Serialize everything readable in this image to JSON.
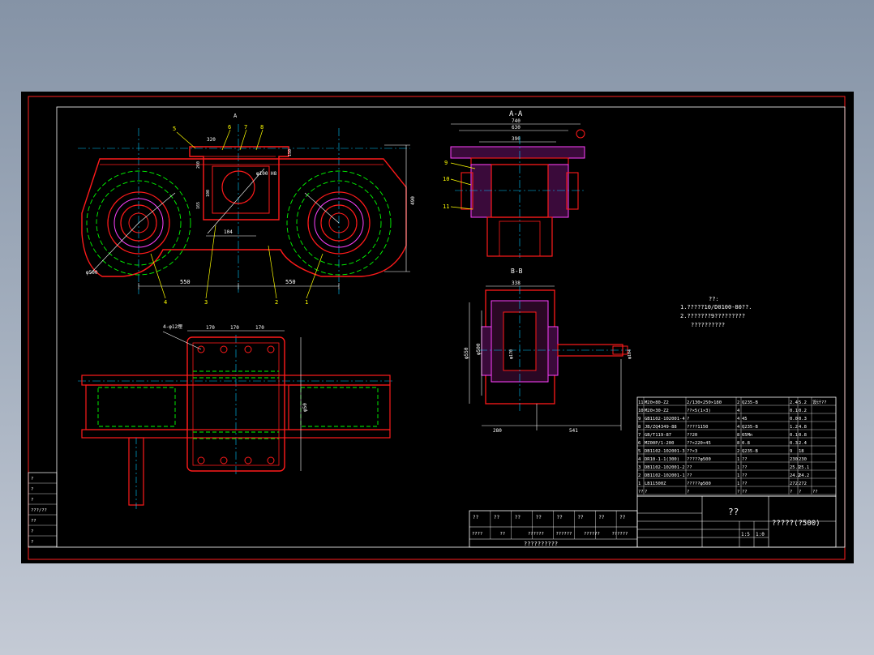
{
  "colors": {
    "frame": "#ff2020",
    "outline": "#ff1a1a",
    "centerline": "#00c8ff",
    "hidden": "#00ff00",
    "dimension": "#ffffff",
    "leader": "#ffff00",
    "hatch": "#ff40ff",
    "text": "#ffffff",
    "background": "#000000"
  },
  "views": {
    "section_aa_title": "A-A",
    "section_bb_title": "B-B"
  },
  "front_view": {
    "dims": [
      "550",
      "550",
      "320",
      "104",
      "φ100 H8",
      "φ500",
      "490",
      "150",
      "165",
      "260",
      "100"
    ],
    "balloons": [
      "5",
      "6",
      "7",
      "8",
      "4",
      "3",
      "2",
      "1"
    ],
    "section_marker": "A"
  },
  "top_view": {
    "dims": [
      "4-φ12埋",
      "170",
      "170",
      "170",
      "φ50"
    ]
  },
  "section_aa": {
    "dims": [
      "740",
      "630",
      "390"
    ],
    "balloons": [
      "9",
      "10",
      "11"
    ]
  },
  "section_bb": {
    "dims": [
      "338",
      "φ550",
      "φ500",
      "280",
      "541",
      "φ104",
      "φ170"
    ]
  },
  "notes": {
    "title": "??:",
    "lines": [
      "1.?????10/D0100-80??.",
      "2.???????9?????????",
      "??????????"
    ]
  },
  "bom": {
    "rows": [
      [
        "11",
        "M20×80-Z2",
        "2/130×250×180",
        "2",
        "Q235-B",
        "2.4",
        "5.2",
        "设计??"
      ],
      [
        "10",
        "M20×30-Z2",
        "??×5(1×3)",
        "4",
        "",
        "0.1",
        "0.2",
        ""
      ],
      [
        "9",
        "GB1102-102001-4",
        "?",
        "4",
        "45",
        "0.0",
        "0.3",
        ""
      ],
      [
        "8",
        "JB/ZQ4349-88",
        "????1150",
        "4",
        "Q235-B",
        "1.2",
        "4.8",
        ""
      ],
      [
        "7",
        "GB/T119-87",
        "??20",
        "8",
        "65Mn",
        "0.1",
        "0.8",
        ""
      ],
      [
        "6",
        "MZ00P/1-200",
        "??×220×45",
        "8",
        "0.8",
        "0.3",
        "2.4",
        ""
      ],
      [
        "5",
        "DB1102-102001-3",
        "??×3",
        "2",
        "Q235-B",
        "9",
        "18",
        ""
      ],
      [
        "4",
        "DR10-1-1(300)",
        "?????φ500",
        "1",
        "??",
        "230",
        "230",
        ""
      ],
      [
        "3",
        "DB1102-102001-2",
        "??",
        "1",
        "??",
        "25.1",
        "25.1",
        ""
      ],
      [
        "2",
        "DB1102-102001-1",
        "??",
        "1",
        "??",
        "24.2",
        "24.2",
        ""
      ],
      [
        "1",
        "LB11500Z",
        "?????φ500",
        "1",
        "??",
        "272",
        "272",
        ""
      ]
    ],
    "header": [
      "??",
      "?",
      "?",
      "?",
      "??",
      "?",
      "?",
      "??"
    ]
  },
  "title_block": {
    "part_name": "??",
    "drawing_name": "?????(?500)",
    "scale": "1:5",
    "sheet": "1:0"
  },
  "revision_block": {
    "top": [
      "??",
      "??",
      "??",
      "??",
      "??",
      "??",
      "??",
      "??"
    ],
    "mid": [
      "????",
      "??",
      "??????",
      "??????",
      "??????",
      "??????"
    ],
    "bottom": [
      "??????????"
    ]
  },
  "left_strip": {
    "labels": [
      "?",
      "?",
      "?",
      "???/??",
      "??",
      "?",
      "?"
    ]
  }
}
